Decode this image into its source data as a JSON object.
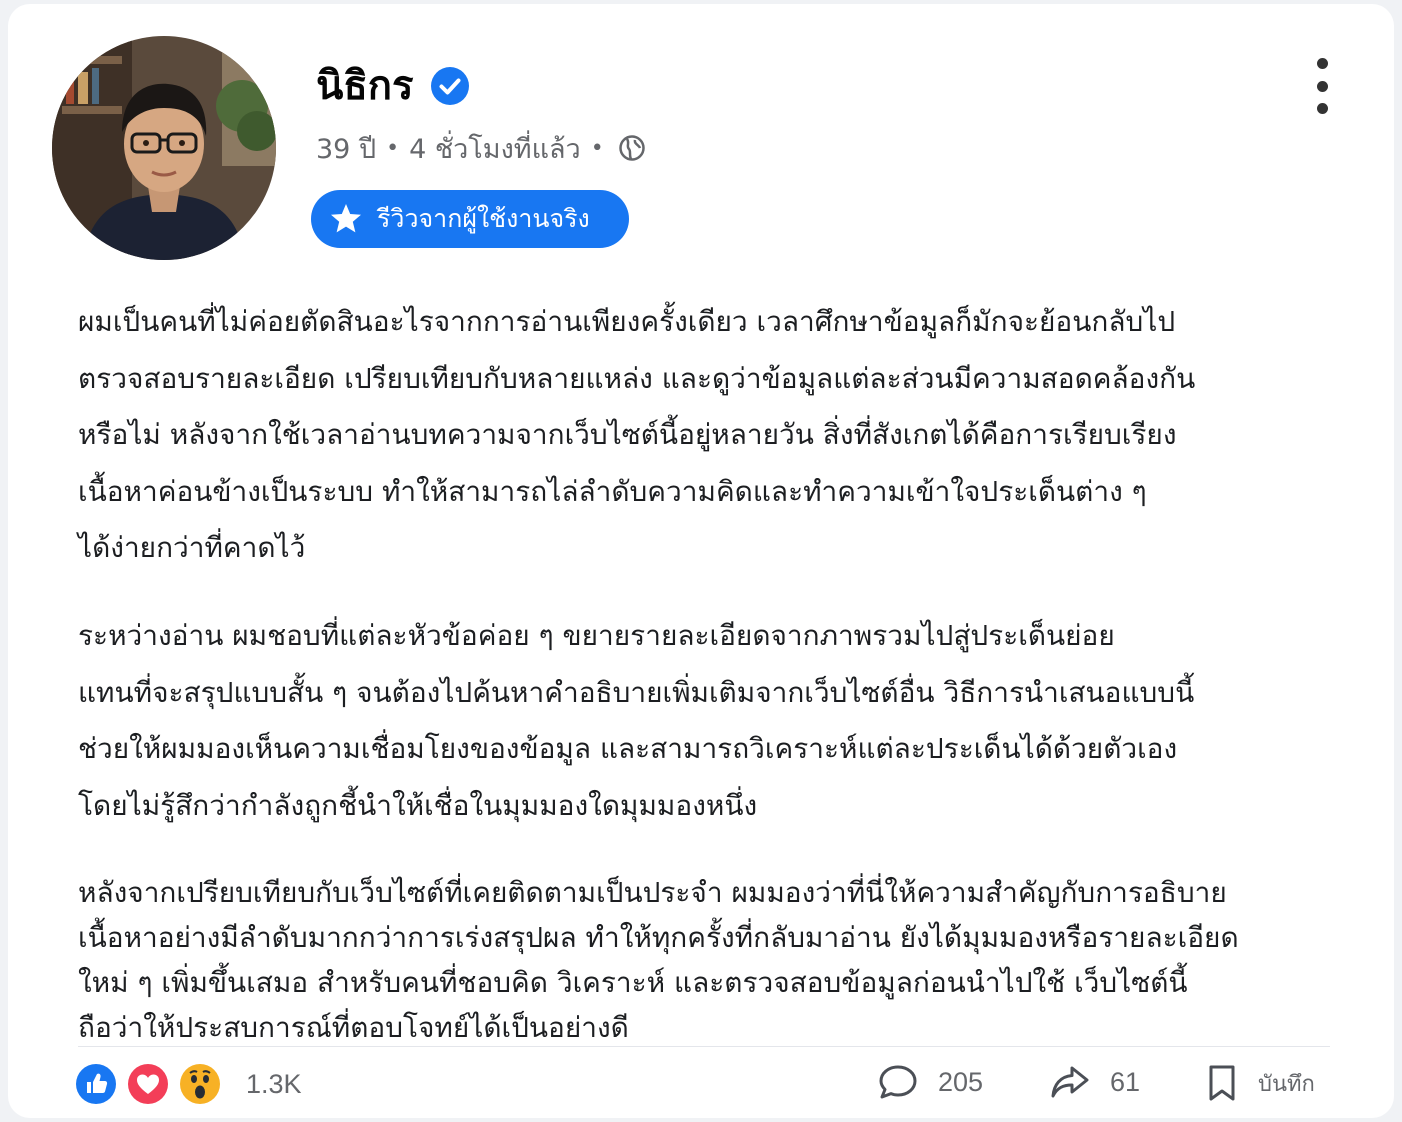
{
  "author": {
    "name": "นิธิกร",
    "verified": true
  },
  "meta": {
    "age": "39 ปี",
    "time": "4 ชั่วโมงที่แล้ว",
    "separator": "•",
    "visibility_icon": "globe-icon"
  },
  "badge": {
    "icon": "star-icon",
    "label": "รีวิวจากผู้ใช้งานจริง"
  },
  "post": {
    "paragraphs": [
      "ผมเป็นคนที่ไม่ค่อยตัดสินอะไรจากการอ่านเพียงครั้งเดียว เวลาศึกษาข้อมูลก็มักจะย้อนกลับไป\nตรวจสอบรายละเอียด เปรียบเทียบกับหลายแหล่ง และดูว่าข้อมูลแต่ละส่วนมีความสอดคล้องกัน\nหรือไม่ หลังจากใช้เวลาอ่านบทความจากเว็บไซต์นี้อยู่หลายวัน สิ่งที่สังเกตได้คือการเรียบเรียง\nเนื้อหาค่อนข้างเป็นระบบ ทำให้สามารถไล่ลำดับความคิดและทำความเข้าใจประเด็นต่าง ๆ\nได้ง่ายกว่าที่คาดไว้",
      "ระหว่างอ่าน ผมชอบที่แต่ละหัวข้อค่อย ๆ ขยายรายละเอียดจากภาพรวมไปสู่ประเด็นย่อย\nแทนที่จะสรุปแบบสั้น ๆ จนต้องไปค้นหาคำอธิบายเพิ่มเติมจากเว็บไซต์อื่น วิธีการนำเสนอแบบนี้\nช่วยให้ผมมองเห็นความเชื่อมโยงของข้อมูล และสามารถวิเคราะห์แต่ละประเด็นได้ด้วยตัวเอง\nโดยไม่รู้สึกว่ากำลังถูกชี้นำให้เชื่อในมุมมองใดมุมมองหนึ่ง",
      "หลังจากเปรียบเทียบกับเว็บไซต์ที่เคยติดตามเป็นประจำ ผมมองว่าที่นี่ให้ความสำคัญกับการอธิบาย\nเนื้อหาอย่างมีลำดับมากกว่าการเร่งสรุปผล ทำให้ทุกครั้งที่กลับมาอ่าน ยังได้มุมมองหรือรายละเอียด\nใหม่ ๆ เพิ่มขึ้นเสมอ สำหรับคนที่ชอบคิด วิเคราะห์ และตรวจสอบข้อมูลก่อนนำไปใช้ เว็บไซต์นี้\nถือว่าให้ประสบการณ์ที่ตอบโจทย์ได้เป็นอย่างดี"
    ]
  },
  "footer": {
    "reactions": [
      "like-icon",
      "love-icon",
      "wow-icon"
    ],
    "reaction_count": "1.3K",
    "comments": "205",
    "shares": "61",
    "save_label": "บันทึก"
  },
  "colors": {
    "accent": "#1877f2",
    "like": "#1877f2",
    "love": "#f33e58",
    "wow": "#f7b125",
    "muted_text": "#65676b"
  }
}
